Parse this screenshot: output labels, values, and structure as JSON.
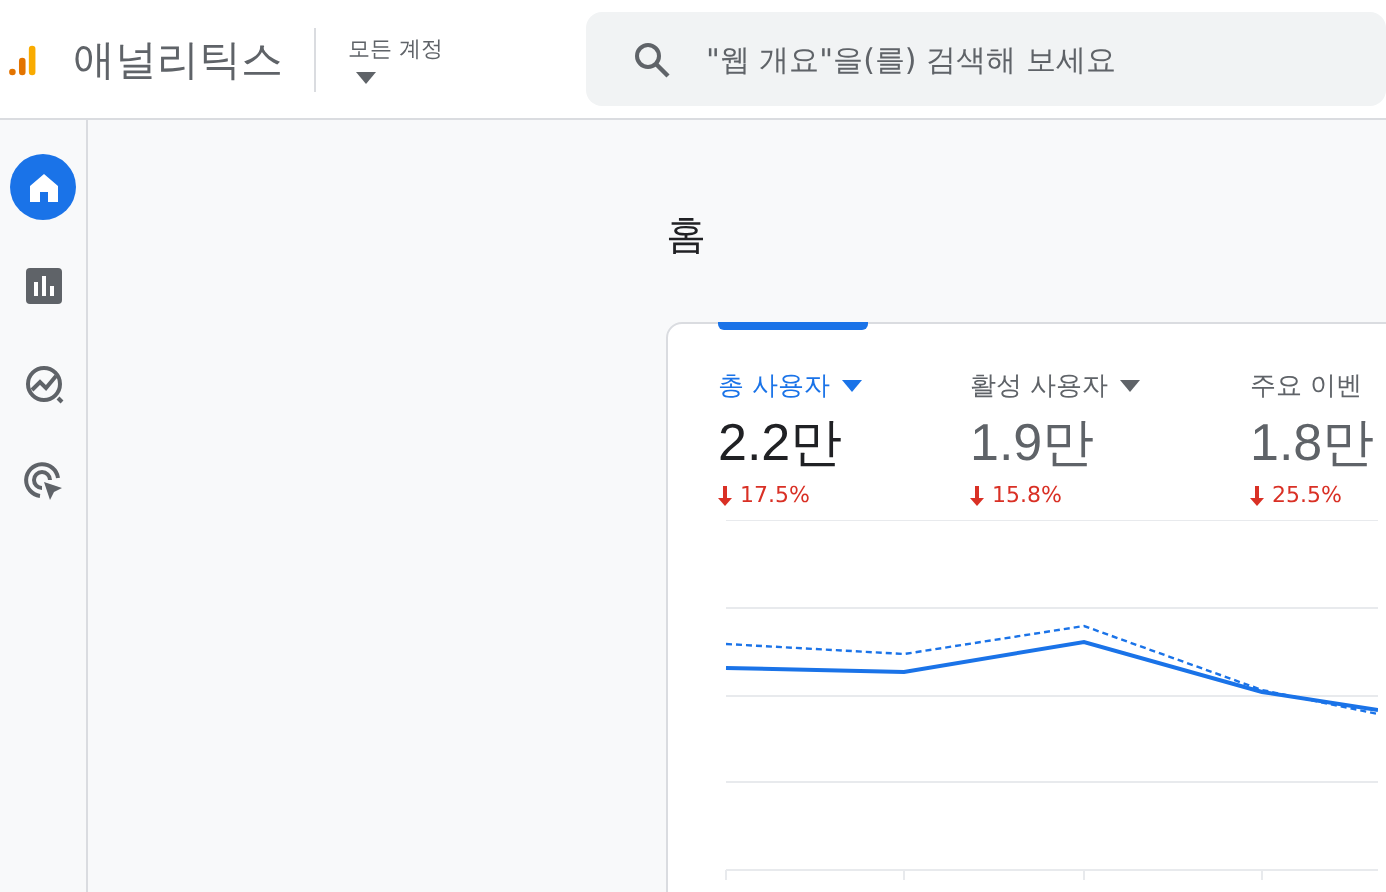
{
  "header": {
    "product": "애널리틱스",
    "account_label": "모든 계정",
    "search": {
      "placeholder": "\"웹 개요\"을(를) 검색해 보세요"
    }
  },
  "nav": [
    {
      "kind": "home",
      "selected": true
    },
    {
      "kind": "reports",
      "selected": false
    },
    {
      "kind": "explore",
      "selected": false
    },
    {
      "kind": "advertising",
      "selected": false
    }
  ],
  "page_title": "홈",
  "metrics": [
    {
      "label": "총 사용자",
      "value": "2.2만",
      "change": "17.5%",
      "selected": true,
      "has_menu": true
    },
    {
      "label": "활성 사용자",
      "value": "1.9만",
      "change": "15.8%",
      "selected": false,
      "has_menu": true
    },
    {
      "label": "주요 이벤",
      "value": "1.8만",
      "change": "25.5%",
      "selected": false,
      "has_menu": false
    }
  ]
}
